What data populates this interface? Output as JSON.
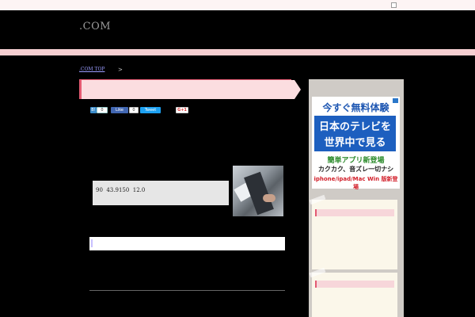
{
  "header": {
    "site_title": ".COM"
  },
  "breadcrumb": {
    "home_label": ".COM TOP",
    "separator": ">"
  },
  "share": {
    "hatena_count": "0",
    "like_label": "Like",
    "like_count": "0",
    "tweet_label": "Tweet",
    "gplus_label": "G+1"
  },
  "main": {
    "data_text": "90  43.9150  12.0"
  },
  "ad": {
    "line1": "今すぐ無料体験",
    "line2": "日本のテレビを",
    "line3": "世界中で見る",
    "line4": "簡単アプリ新登場",
    "line5": "カクカク、音ズレ一切ナシ",
    "line6": "iphone/ipad/Mac Win 版新登場"
  },
  "colors": {
    "page_bg": "#000000",
    "accent_pink": "#f6cfd2",
    "ribbon_red": "#e35a72",
    "ad_blue": "#1d5fbf"
  }
}
